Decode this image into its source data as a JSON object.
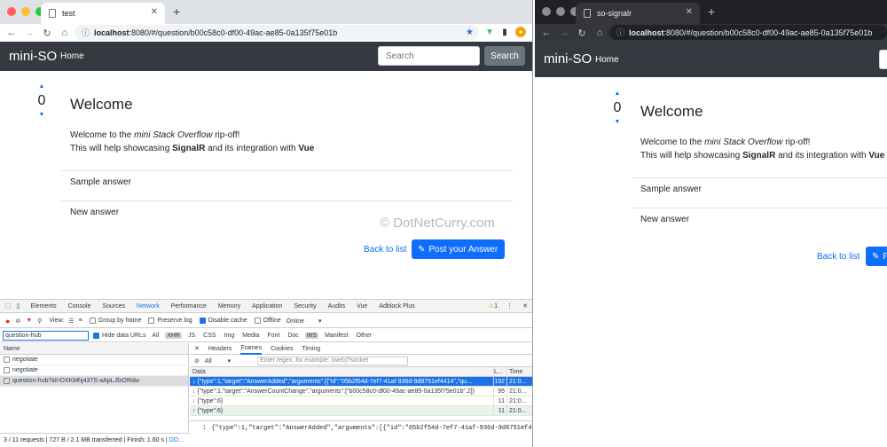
{
  "left_window": {
    "tab_title": "test",
    "url_host": "localhost",
    "url_rest": ":8080/#/question/b00c58c0-df00-49ac-ae85-0a135f75e01b"
  },
  "right_window": {
    "tab_title": "so-signalr",
    "url_host": "localhost",
    "url_rest": ":8080/#/question/b00c58c0-df00-49ac-ae85-0a135f75e01b"
  },
  "app": {
    "brand": "mini-SO",
    "home_label": "Home",
    "search_placeholder": "Search",
    "search_button": "Search",
    "vote_count": "0",
    "title": "Welcome",
    "line1_pre": "Welcome to the ",
    "line1_em": "mini Stack Overflow",
    "line1_post": " rip-off!",
    "line2_pre": "This will help showcasing ",
    "line2_b1": "SignalR",
    "line2_mid": " and its integration with ",
    "line2_b2": "Vue",
    "answers": [
      "Sample answer",
      "New answer"
    ],
    "back_link": "Back to list",
    "post_button": "Post your Answer"
  },
  "watermark": "© DotNetCurry.com",
  "devtools": {
    "tabs": [
      "Elements",
      "Console",
      "Sources",
      "Network",
      "Performance",
      "Memory",
      "Application",
      "Security",
      "Audits",
      "Vue",
      "Adblock Plus"
    ],
    "selected_tab": "Network",
    "warning_count": "1",
    "view_label": "View:",
    "group_by_frame": "Group by frame",
    "preserve_log": "Preserve log",
    "disable_cache": "Disable cache",
    "offline": "Offline",
    "throttle": "Online",
    "filter_value": "question-hub",
    "hide_data_urls": "Hide data URLs",
    "filter_types": [
      "All",
      "XHR",
      "JS",
      "CSS",
      "Img",
      "Media",
      "Font",
      "Doc",
      "WS",
      "Manifest",
      "Other"
    ],
    "name_header": "Name",
    "requests": [
      "negotiate",
      "negotiate",
      "question-hub?id=DXKMhj437S-aApLJfzORdw"
    ],
    "frame_tabs": [
      "Headers",
      "Frames",
      "Cookies",
      "Timing"
    ],
    "frame_filter_select": "All",
    "frame_filter_placeholder": "Enter regex, for example: (web)?socket",
    "frame_columns": [
      "Data",
      "L...",
      "Time"
    ],
    "frames": [
      {
        "dir": "down",
        "data": "{\"type\":1,\"target\":\"AnswerAdded\",\"arguments\":[{\"id\":\"05b2f54d-7ef7-41af-936d-9d8751ef4414\",\"qu...",
        "len": "192",
        "time": "21:0..."
      },
      {
        "dir": "down",
        "data": "{\"type\":1,\"target\":\"AnswerCountChange\",\"arguments\":[\"b00c58c0-df00-49ac-ae85-0a135f75e01b\",2]}",
        "len": "95",
        "time": "21:0..."
      },
      {
        "dir": "down",
        "data": "{\"type\":6}",
        "len": "11",
        "time": "21:0..."
      },
      {
        "dir": "up",
        "data": "{\"type\":6}",
        "len": "11",
        "time": "21:0..."
      }
    ],
    "detail_line_no": "1",
    "detail_text": "{\"type\":1,\"target\":\"AnswerAdded\",\"arguments\":[{\"id\":\"05b2f54d-7ef7-41af-936d-9d8751ef4414\",\"q",
    "status_text": "3 / 11 requests | 727 B / 2.1 MB transferred | Finish: 1.60 s | ",
    "status_link": "DO..."
  }
}
